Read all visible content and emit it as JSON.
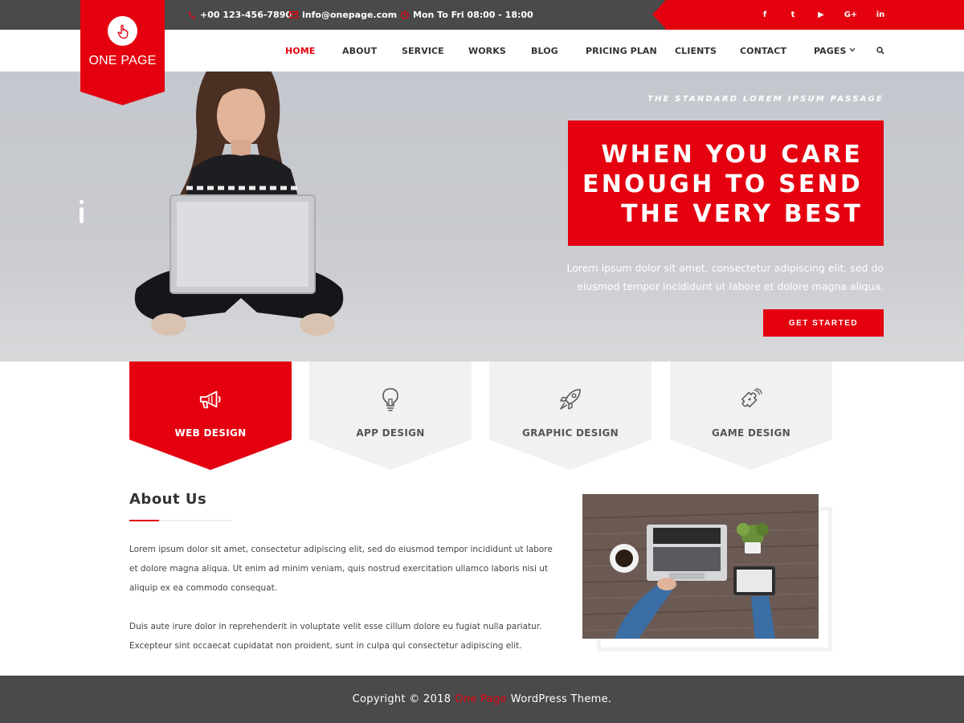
{
  "colors": {
    "accent": "#e4000f",
    "dark_bar": "#4a4a4a",
    "text": "#444444",
    "service_bg": "#f1f1f1"
  },
  "topbar": {
    "phone": "+00 123-456-7890",
    "email": "info@onepage.com",
    "hours": "Mon To Fri 08:00 - 18:00",
    "social": [
      {
        "name": "facebook-icon",
        "glyph": "f"
      },
      {
        "name": "twitter-icon",
        "glyph": "t"
      },
      {
        "name": "youtube-icon",
        "glyph": "▶"
      },
      {
        "name": "google-plus-icon",
        "glyph": "G+"
      },
      {
        "name": "linkedin-icon",
        "glyph": "in"
      }
    ]
  },
  "logo": {
    "text": "ONE PAGE",
    "icon": "hand-pointer-icon"
  },
  "nav": {
    "items": [
      "HOME",
      "ABOUT",
      "SERVICE",
      "WORKS",
      "BLOG",
      "PRICING PLAN",
      "CLIENTS",
      "CONTACT",
      "PAGES"
    ],
    "active": "HOME",
    "search_icon": "search-icon"
  },
  "hero": {
    "kicker": "THE STANDARD LOREM IPSUM PASSAGE",
    "headline": "WHEN YOU CARE\nENOUGH TO SEND\nTHE VERY BEST",
    "lead": "Lorem ipsum dolor sit amet, consectetur adipiscing elit, sed do eiusmod tempor incididunt ut labore et dolore magna aliqua.",
    "cta": "GET STARTED"
  },
  "services": [
    {
      "label": "WEB DESIGN",
      "icon": "megaphone-icon",
      "active": true
    },
    {
      "label": "APP DESIGN",
      "icon": "lightbulb-icon",
      "active": false
    },
    {
      "label": "GRAPHIC DESIGN",
      "icon": "rocket-icon",
      "active": false
    },
    {
      "label": "GAME DESIGN",
      "icon": "puzzle-icon",
      "active": false
    }
  ],
  "about": {
    "title": "About Us",
    "p1": "Lorem ipsum dolor sit amet, consectetur adipiscing elit, sed do eiusmod tempor incididunt ut labore et dolore magna aliqua. Ut enim ad minim veniam, quis nostrud exercitation ullamco laboris nisi ut aliquip ex ea commodo consequat.",
    "p2": "Duis aute irure dolor in reprehenderit in voluptate velit esse cillum dolore eu fugiat nulla pariatur. Excepteur sint occaecat cupidatat non proident, sunt in culpa qui consectetur adipiscing elit."
  },
  "footer": {
    "prefix": "Copyright © 2018",
    "brand": "One Page",
    "suffix": "WordPress Theme."
  }
}
